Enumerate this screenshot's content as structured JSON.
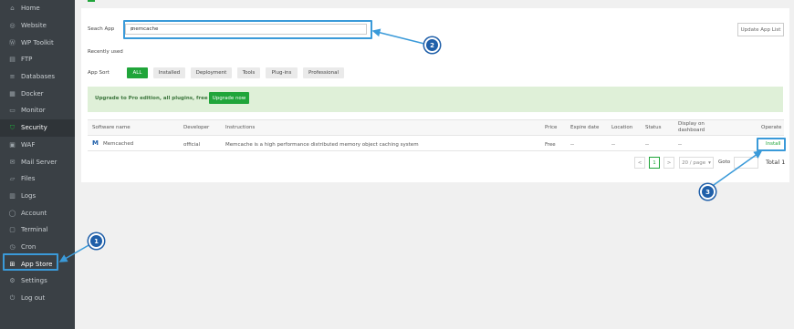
{
  "sidebar": {
    "items": [
      {
        "label": "Home",
        "icon": "home-icon",
        "glyph": "⌂"
      },
      {
        "label": "Website",
        "icon": "globe-icon",
        "glyph": "◎"
      },
      {
        "label": "WP Toolkit",
        "icon": "wordpress-icon",
        "glyph": "Ⓦ"
      },
      {
        "label": "FTP",
        "icon": "ftp-icon",
        "glyph": "▤"
      },
      {
        "label": "Databases",
        "icon": "database-icon",
        "glyph": "≡"
      },
      {
        "label": "Docker",
        "icon": "docker-icon",
        "glyph": "▦"
      },
      {
        "label": "Monitor",
        "icon": "monitor-icon",
        "glyph": "▭"
      },
      {
        "label": "Security",
        "icon": "shield-icon",
        "glyph": "⛉"
      },
      {
        "label": "WAF",
        "icon": "waf-icon",
        "glyph": "▣"
      },
      {
        "label": "Mail Server",
        "icon": "mail-icon",
        "glyph": "✉"
      },
      {
        "label": "Files",
        "icon": "folder-icon",
        "glyph": "▱"
      },
      {
        "label": "Logs",
        "icon": "logs-icon",
        "glyph": "▥"
      },
      {
        "label": "Account",
        "icon": "user-icon",
        "glyph": "◯"
      },
      {
        "label": "Terminal",
        "icon": "terminal-icon",
        "glyph": "▢"
      },
      {
        "label": "Cron",
        "icon": "clock-icon",
        "glyph": "◷"
      },
      {
        "label": "App Store",
        "icon": "grid-icon",
        "glyph": "⊞"
      },
      {
        "label": "Settings",
        "icon": "gear-icon",
        "glyph": "⚙"
      },
      {
        "label": "Log out",
        "icon": "logout-icon",
        "glyph": "⏻"
      }
    ],
    "active": "Security"
  },
  "search": {
    "label": "Seach App",
    "value": "memcache"
  },
  "recently_used": "Recently used",
  "update_button": "Update App List",
  "sort": {
    "label": "App Sort",
    "options": [
      "ALL",
      "Installed",
      "Deployment",
      "Tools",
      "Plug-ins",
      "Professional"
    ],
    "selected": "ALL"
  },
  "banner": {
    "text": "Upgrade to Pro edition, all plugins, free to use!",
    "button": "Upgrade now"
  },
  "table": {
    "headers": [
      "Software name",
      "Developer",
      "Instructions",
      "Price",
      "Expire date",
      "Location",
      "Status",
      "Display on dashboard",
      "Operate"
    ],
    "rows": [
      {
        "name": "Memcached",
        "developer": "official",
        "instructions": "Memcache is a high performance distributed memory object caching system",
        "price": "Free",
        "expire": "--",
        "location": "--",
        "status": "--",
        "display": "--",
        "operate": "Install"
      }
    ]
  },
  "pagination": {
    "prev": "<",
    "current": "1",
    "next": ">",
    "per_page": "20 / page",
    "goto": "Goto",
    "total": "Total 1"
  },
  "annotations": [
    "1",
    "2",
    "3"
  ],
  "colors": {
    "accent": "#20a53a",
    "callout": "#3a9ad9",
    "badge": "#1f5fa9",
    "sidebar": "#3a4045"
  }
}
